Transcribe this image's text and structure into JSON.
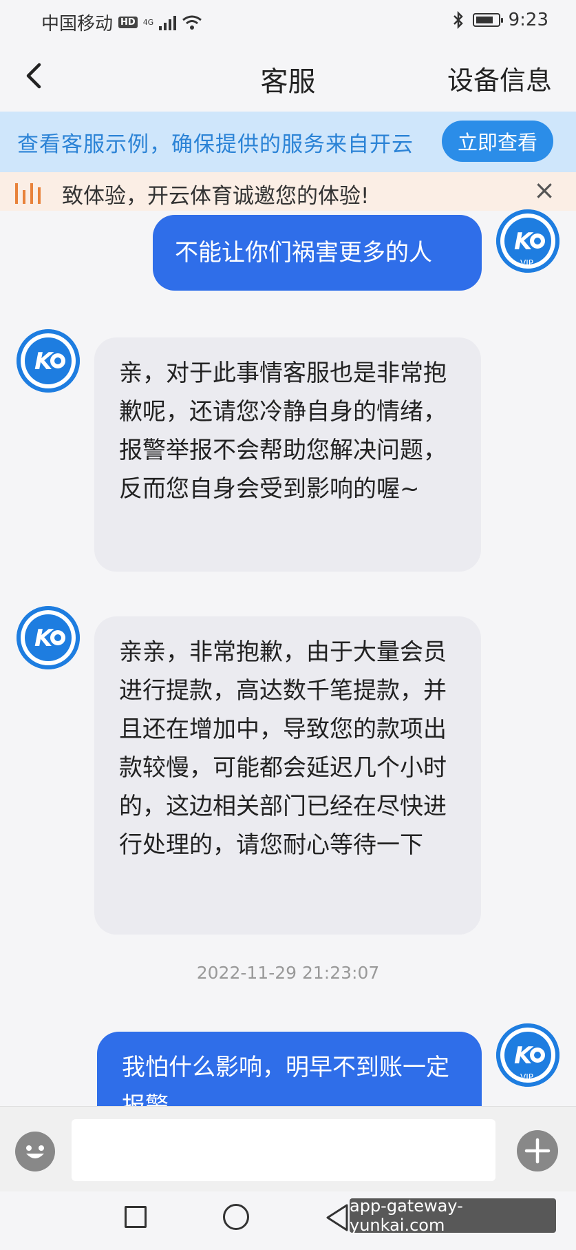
{
  "status_bar": {
    "carrier": "中国移动",
    "hd": "HD",
    "network": "4G",
    "time": "9:23"
  },
  "nav": {
    "title": "客服",
    "right_label": "设备信息"
  },
  "banner": {
    "text": "查看客服示例，确保提供的服务来自开云",
    "button_label": "立即查看"
  },
  "notice": {
    "text": "致体验，开云体育诚邀您的体验!"
  },
  "messages": [
    {
      "from": "user",
      "text": "不能让你们祸害更多的人",
      "avatar_label": "VIP"
    },
    {
      "from": "agent",
      "text": "亲，对于此事情客服也是非常抱歉呢，还请您冷静自身的情绪，报警举报不会帮助您解决问题，反而您自身会受到影响的喔~"
    },
    {
      "from": "agent",
      "text": "亲亲，非常抱歉，由于大量会员进行提款，高达数千笔提款，并且还在增加中，导致您的款项出款较慢，可能都会延迟几个小时的，这边相关部门已经在尽快进行处理的，请您耐心等待一下"
    },
    {
      "from": "user",
      "text": "我怕什么影响，明早不到账一定报警",
      "avatar_label": "VIP"
    }
  ],
  "timestamp": "2022-11-29 21:23:07",
  "input": {
    "value": "",
    "placeholder": ""
  },
  "watermark": "app-gateway-yunkai.com",
  "colors": {
    "accent": "#2f6ee9",
    "banner_bg": "#cfe6fb",
    "banner_text": "#2b83d6",
    "notice_bg": "#fbeee5",
    "agent_bubble": "#ebebf0"
  }
}
